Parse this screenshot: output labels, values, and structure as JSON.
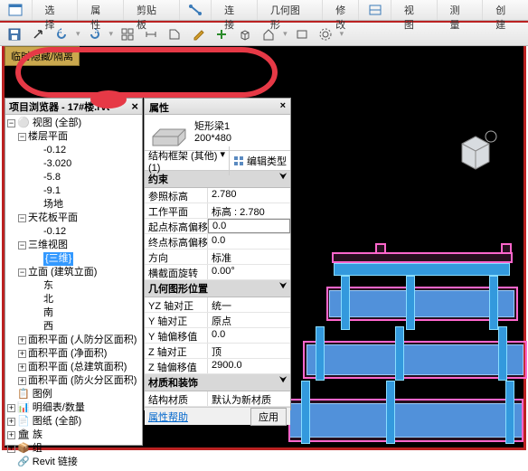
{
  "ribbon": {
    "tabs": [
      "选择",
      "属性",
      "剪贴板",
      "连接",
      "几何图形",
      "修改",
      "视图",
      "测量",
      "创建"
    ]
  },
  "temp_hide": "临时隐藏/隔离",
  "browser": {
    "title": "项目浏览器 - 17#楼.rvt",
    "root": "视图 (全部)",
    "floorplan": "楼层平面",
    "levels1": [
      "-0.12",
      "-3.020",
      "-5.8",
      "-9.1",
      "场地"
    ],
    "ceiling": "天花板平面",
    "levels2": [
      "-0.12"
    ],
    "threeD": "三维视图",
    "threeD_item": "{三维}",
    "elev": "立面 (建筑立面)",
    "elev_items": [
      "东",
      "北",
      "南",
      "西"
    ],
    "area1": "面积平面 (人防分区面积)",
    "area2": "面积平面 (净面积)",
    "area3": "面积平面 (总建筑面积)",
    "area4": "面积平面 (防火分区面积)",
    "legend": "图例",
    "sched": "明细表/数量",
    "sheets": "图纸 (全部)",
    "fam": "族",
    "grp": "组",
    "links": "Revit 链接"
  },
  "props": {
    "title": "属性",
    "fam_name": "矩形梁1",
    "fam_size": "200*480",
    "selector": "结构框架 (其他) (1)",
    "edit_type": "编辑类型",
    "group_constraints": "约束",
    "ref_level_lbl": "参照标高",
    "ref_level_val": "2.780",
    "workplane_lbl": "工作平面",
    "workplane_val": "标高 : 2.780",
    "start_off_lbl": "起点标高偏移",
    "start_off_val": "0.0",
    "end_off_lbl": "终点标高偏移",
    "end_off_val": "0.0",
    "orient_lbl": "方向",
    "orient_val": "标准",
    "rot_lbl": "横截面旋转",
    "rot_val": "0.00°",
    "group_geom": "几何图形位置",
    "yz_lbl": "YZ 轴对正",
    "yz_val": "统一",
    "y_lbl": "Y 轴对正",
    "y_val": "原点",
    "yoff_lbl": "Y 轴偏移值",
    "yoff_val": "0.0",
    "z_lbl": "Z 轴对正",
    "z_val": "顶",
    "zoff_lbl": "Z 轴偏移值",
    "zoff_val": "2900.0",
    "group_mat": "材质和装饰",
    "mat_lbl": "结构材质",
    "mat_val": "默认为新材质",
    "help": "属性帮助",
    "apply": "应用"
  }
}
